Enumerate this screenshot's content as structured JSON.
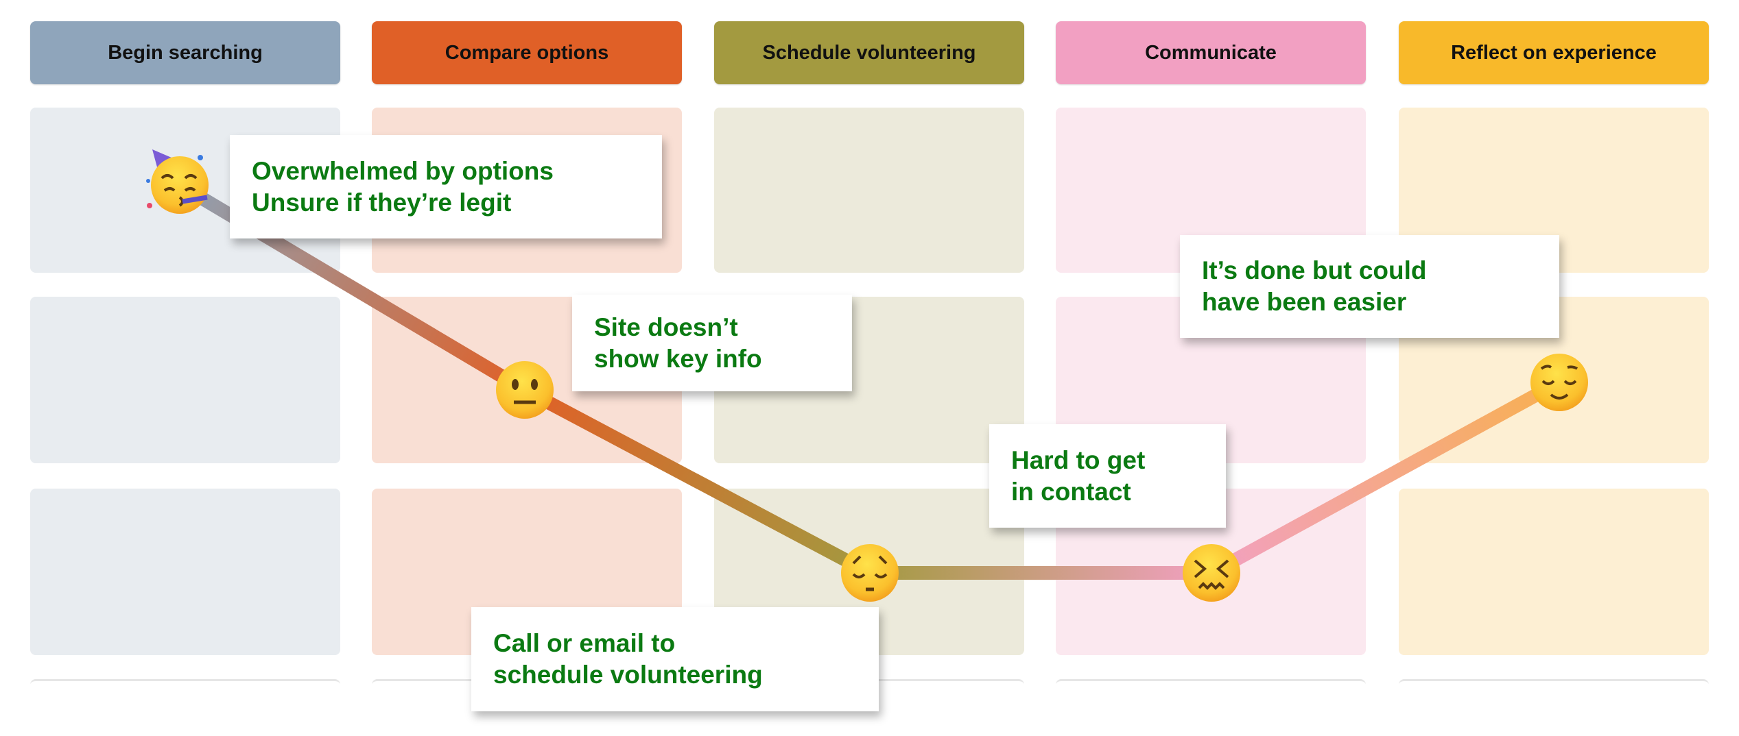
{
  "stages": [
    {
      "label": "Begin searching",
      "color": "#8fa5bb",
      "cell_color": "#e8ecf0"
    },
    {
      "label": "Compare options",
      "color": "#e06027",
      "cell_color": "#f9dfd4"
    },
    {
      "label": "Schedule volunteering",
      "color": "#a39a40",
      "cell_color": "#eceadb"
    },
    {
      "label": "Communicate",
      "color": "#f2a0c2",
      "cell_color": "#fbe8ef"
    },
    {
      "label": "Reflect on experience",
      "color": "#f8b92a",
      "cell_color": "#fdefd3"
    }
  ],
  "emotions": [
    "partying-face-icon",
    "neutral-face-icon",
    "pensive-face-icon",
    "confounded-face-icon",
    "relieved-face-icon"
  ],
  "callouts": [
    {
      "lines": [
        "Overwhelmed by options",
        "Unsure if they’re legit"
      ]
    },
    {
      "lines": [
        "Site doesn’t",
        "show key info"
      ]
    },
    {
      "lines": [
        "Call or email to",
        "schedule volunteering"
      ]
    },
    {
      "lines": [
        "Hard to get",
        "in contact"
      ]
    },
    {
      "lines": [
        "It’s done but could",
        "have been easier"
      ]
    }
  ],
  "text_color": "#0b7a12"
}
